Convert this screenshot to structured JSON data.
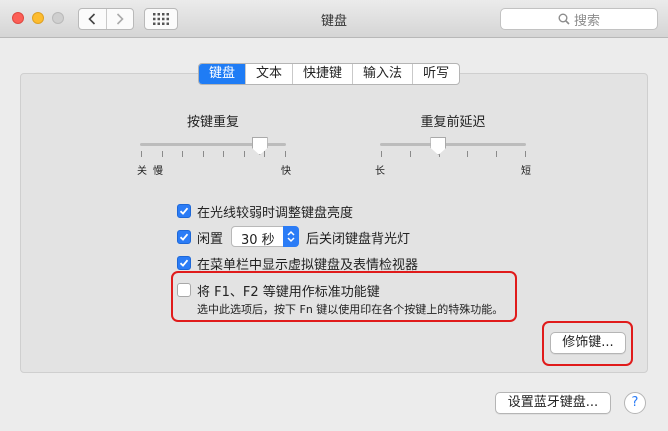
{
  "window": {
    "title": "键盘"
  },
  "toolbar": {
    "search_placeholder": "搜索"
  },
  "tabs": [
    {
      "label": "键盘",
      "active": true
    },
    {
      "label": "文本",
      "active": false
    },
    {
      "label": "快捷键",
      "active": false
    },
    {
      "label": "输入法",
      "active": false
    },
    {
      "label": "听写",
      "active": false
    }
  ],
  "key_repeat": {
    "title": "按键重复",
    "left_labels": [
      "关",
      "慢"
    ],
    "right_label": "快",
    "level": 0.82
  },
  "repeat_delay": {
    "title": "重复前延迟",
    "left_label": "长",
    "right_label": "短",
    "level": 0.4
  },
  "options": {
    "adjust_brightness": {
      "label": "在光线较弱时调整键盘亮度",
      "checked": true
    },
    "idle": {
      "label_before": "闲置",
      "select_value": "30 秒",
      "label_after": "后关闭键盘背光灯",
      "checked": true
    },
    "show_viewer": {
      "label": "在菜单栏中显示虚拟键盘及表情检视器",
      "checked": true
    },
    "fn_keys": {
      "label": "将 F1、F2 等键用作标准功能键",
      "description": "选中此选项后，按下 Fn 键以使用印在各个按键上的特殊功能。",
      "checked": false
    }
  },
  "buttons": {
    "modifier_keys": "修饰键...",
    "setup_bluetooth": "设置蓝牙键盘...",
    "help": "?"
  },
  "colors": {
    "accent": "#2b7cf6",
    "highlight": "#e01b1b"
  }
}
